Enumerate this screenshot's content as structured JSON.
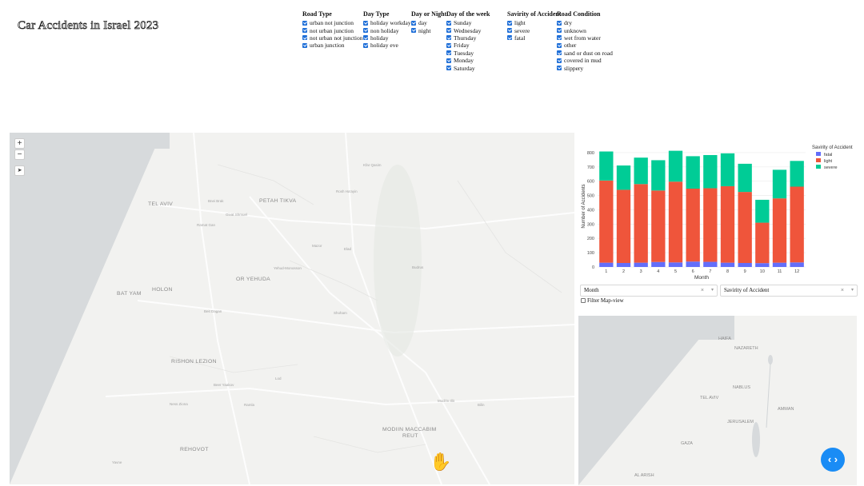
{
  "title": "Car Accidents in Israel 2023",
  "filters": [
    {
      "id": "road-type",
      "heading": "Road Type",
      "options": [
        "urban not junction",
        "not urban junction",
        "not urban not junction",
        "urban junction"
      ]
    },
    {
      "id": "day-type",
      "heading": "Day Type",
      "options": [
        "holiday workday",
        "non holiday",
        "holiday",
        "holiday eve"
      ]
    },
    {
      "id": "day-night",
      "heading": "Day or Night",
      "options": [
        "day",
        "night"
      ]
    },
    {
      "id": "day-of-week",
      "heading": "Day of the week",
      "options": [
        "Sunday",
        "Wednesday",
        "Thursday",
        "Friday",
        "Tuesday",
        "Monday",
        "Saturday"
      ]
    },
    {
      "id": "severity",
      "heading": "Savirity of Accident",
      "options": [
        "light",
        "severe",
        "fatal"
      ]
    },
    {
      "id": "road-condition",
      "heading": "Road Condition",
      "options": [
        "dry",
        "unknown",
        "wet from water",
        "other",
        "sand or dust on road",
        "covered in mud",
        "slippery"
      ]
    }
  ],
  "map_labels": [
    {
      "text": "TEL AVIV",
      "size": "big"
    },
    {
      "text": "PETAH TIKVA",
      "size": "big"
    },
    {
      "text": "OR YEHUDA",
      "size": "big"
    },
    {
      "text": "HOLON",
      "size": "big"
    },
    {
      "text": "BAT YAM",
      "size": "big"
    },
    {
      "text": "RISHON LEZION",
      "size": "big"
    },
    {
      "text": "REHOVOT",
      "size": "big"
    },
    {
      "text": "MODIIN MACCABIM",
      "size": "big"
    },
    {
      "text": "REUT",
      "size": "big"
    },
    {
      "text": "Bnei Brak",
      "size": "sm"
    },
    {
      "text": "Ramat Gan",
      "size": "sm"
    },
    {
      "text": "Givat Shmuel",
      "size": "sm"
    },
    {
      "text": "Kfar Qasim",
      "size": "sm"
    },
    {
      "text": "Rosh Ha'ayin",
      "size": "sm"
    },
    {
      "text": "Budrus",
      "size": "sm"
    },
    {
      "text": "Shoham",
      "size": "sm"
    },
    {
      "text": "Beit Dagan",
      "size": "sm"
    },
    {
      "text": "Yehud-Monosson",
      "size": "sm"
    },
    {
      "text": "Lod",
      "size": "sm"
    },
    {
      "text": "Ramla",
      "size": "sm"
    },
    {
      "text": "Ness Ziona",
      "size": "sm"
    },
    {
      "text": "Beer Yaakov",
      "size": "sm"
    },
    {
      "text": "Yavne",
      "size": "sm"
    },
    {
      "text": "Modi'in Illit",
      "size": "sm"
    },
    {
      "text": "Bilin",
      "size": "sm"
    },
    {
      "text": "Elad",
      "size": "sm"
    },
    {
      "text": "Mazor",
      "size": "sm"
    }
  ],
  "mini_map_labels": [
    "HAIFA",
    "NAZARETH",
    "NABLUS",
    "TEL AVIV",
    "AMMAN",
    "JERUSALEM",
    "GAZA",
    "AL ARISH"
  ],
  "chart": {
    "ylabel": "Number of Accidents",
    "xlabel": "Month",
    "legend_title": "Savirity of Accident",
    "colors": {
      "fatal": "#636efa",
      "light": "#ef553b",
      "severe": "#00cc96"
    }
  },
  "chart_data": {
    "type": "bar",
    "categories": [
      "1",
      "2",
      "3",
      "4",
      "5",
      "6",
      "7",
      "8",
      "9",
      "10",
      "11",
      "12"
    ],
    "series": [
      {
        "name": "fatal",
        "values": [
          30,
          28,
          30,
          35,
          32,
          38,
          36,
          30,
          28,
          27,
          30,
          32
        ]
      },
      {
        "name": "light",
        "values": [
          575,
          512,
          550,
          500,
          565,
          510,
          515,
          535,
          497,
          283,
          450,
          530
        ]
      },
      {
        "name": "severe",
        "values": [
          203,
          170,
          185,
          212,
          216,
          227,
          232,
          230,
          197,
          160,
          200,
          180
        ]
      }
    ],
    "xlabel": "Month",
    "ylabel": "Number of Accidents",
    "ylim": [
      0,
      850
    ],
    "yticks": [
      0,
      100,
      200,
      300,
      400,
      500,
      600,
      700,
      800
    ],
    "legend_position": "right"
  },
  "dropdowns": {
    "x_axis": {
      "value": "Month",
      "clear": "×",
      "caret": "▾"
    },
    "color": {
      "value": "Savirity of Accident",
      "clear": "×",
      "caret": "▾"
    }
  },
  "filter_map_view_label": "Filter Map-view",
  "code_button_glyph": "‹ ›",
  "map_controls": {
    "zoom_in": "+",
    "zoom_out": "−",
    "locate": "➤"
  }
}
